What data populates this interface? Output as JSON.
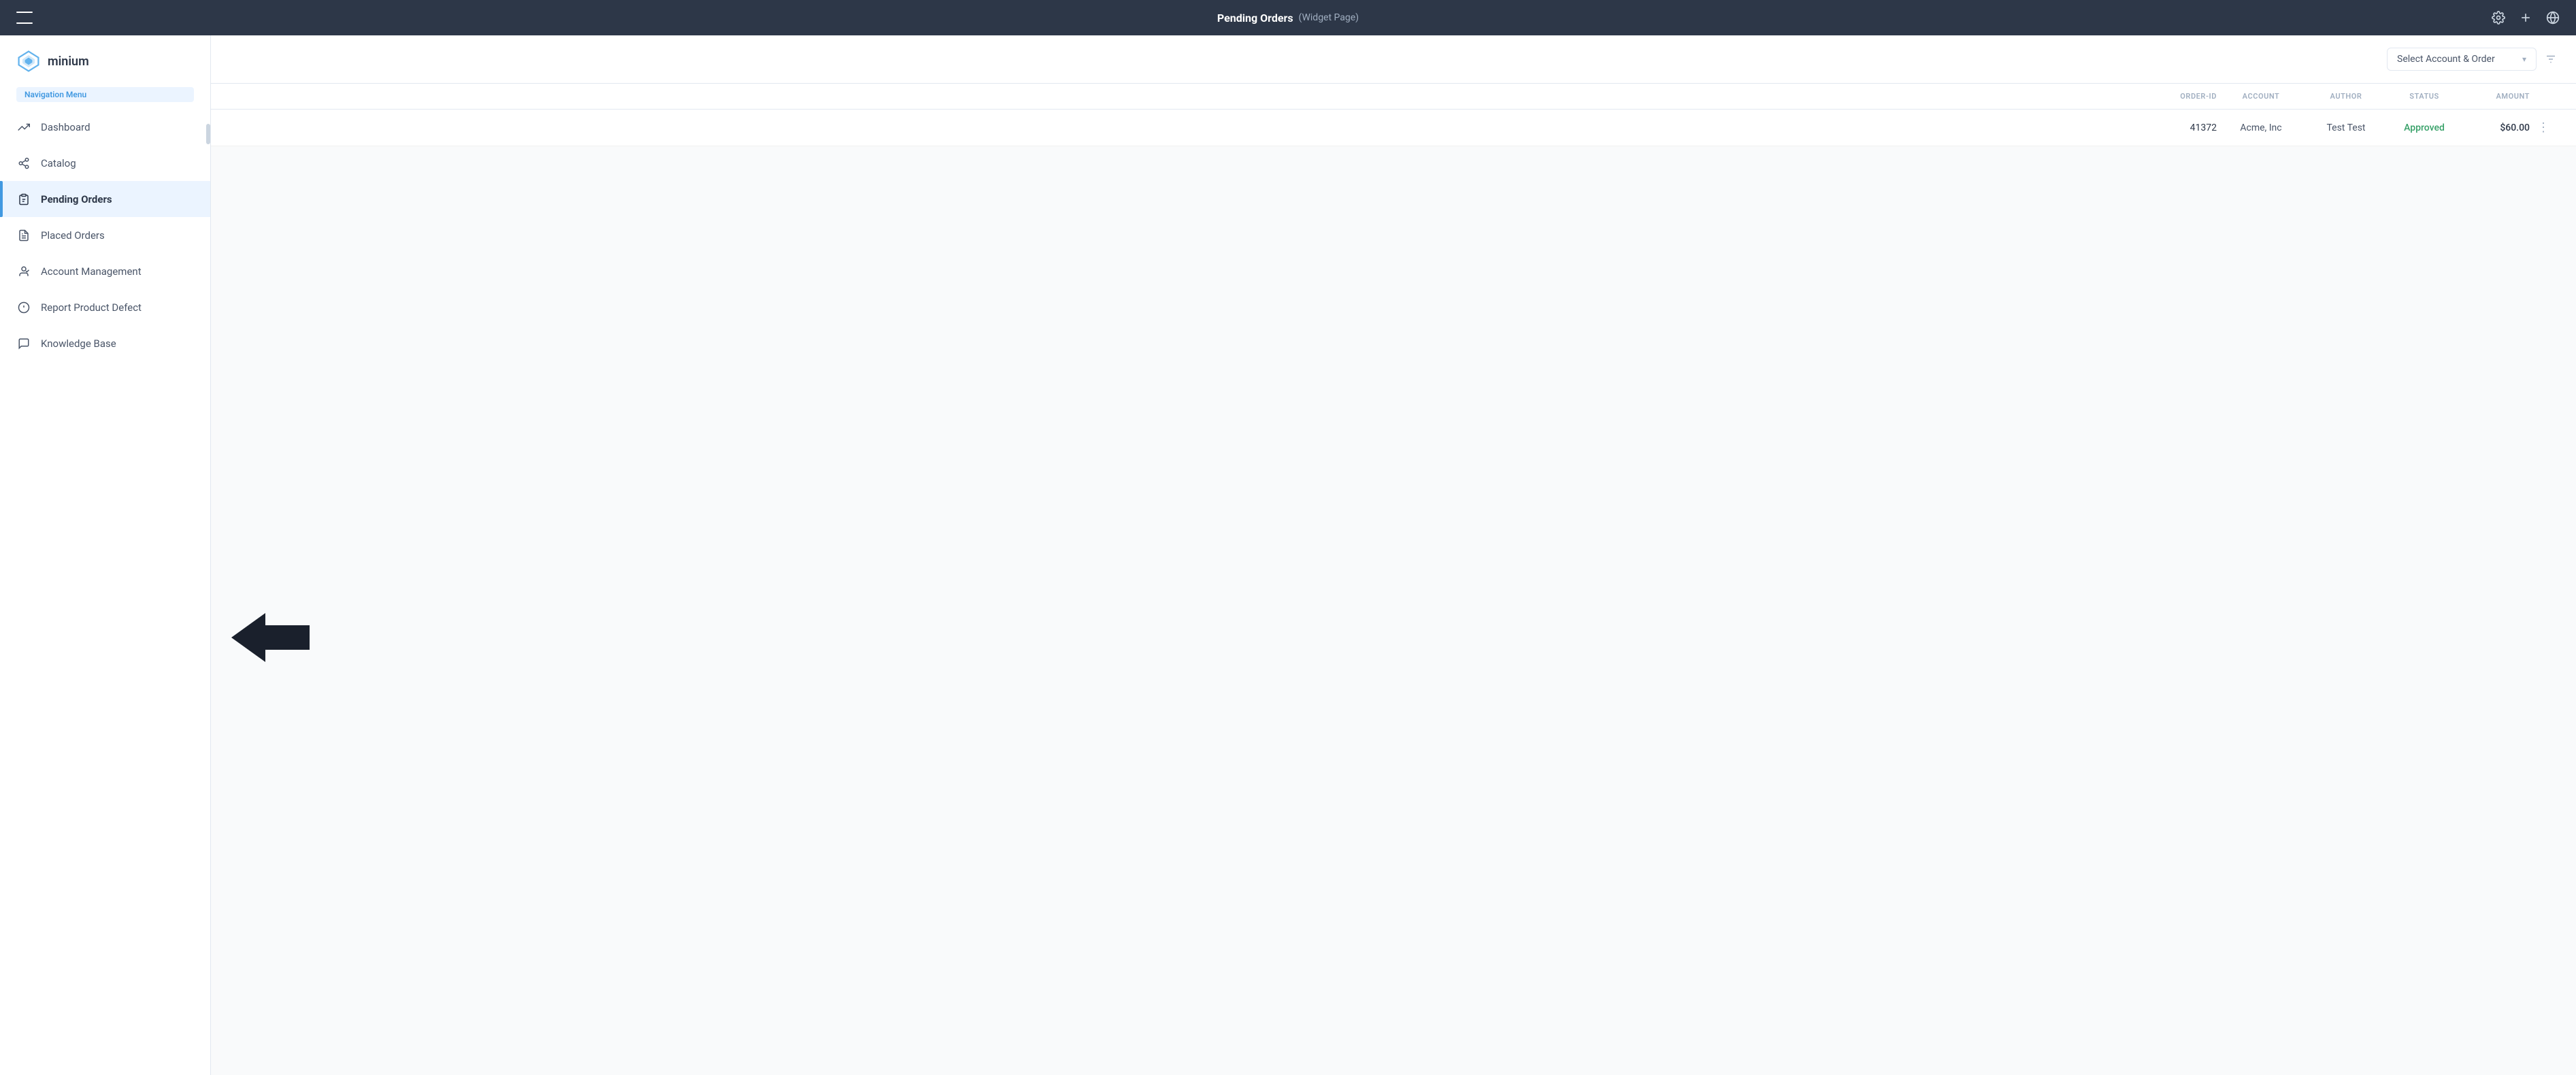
{
  "topbar": {
    "title": "Pending Orders",
    "subtitle": "(Widget Page)",
    "icons": {
      "sidebar_toggle": "sidebar-toggle",
      "settings": "⚙",
      "add": "+",
      "globe": "🌐"
    }
  },
  "sidebar": {
    "logo_text": "minium",
    "nav_menu_label": "Navigation Menu",
    "items": [
      {
        "id": "dashboard",
        "label": "Dashboard",
        "icon": "trending-up",
        "active": false
      },
      {
        "id": "catalog",
        "label": "Catalog",
        "icon": "tag",
        "active": false
      },
      {
        "id": "pending-orders",
        "label": "Pending Orders",
        "icon": "clipboard-list",
        "active": true
      },
      {
        "id": "placed-orders",
        "label": "Placed Orders",
        "icon": "file-text",
        "active": false
      },
      {
        "id": "account-management",
        "label": "Account Management",
        "icon": "user-check",
        "active": false
      },
      {
        "id": "report-defect",
        "label": "Report Product Defect",
        "icon": "alert-circle",
        "active": false
      },
      {
        "id": "knowledge-base",
        "label": "Knowledge Base",
        "icon": "message-square",
        "active": false
      }
    ]
  },
  "content_header": {
    "select_placeholder": "Select Account & Order",
    "chevron": "▾"
  },
  "table": {
    "columns": [
      {
        "id": "order-id",
        "label": "ORDER-ID"
      },
      {
        "id": "account",
        "label": "ACCOUNT"
      },
      {
        "id": "author",
        "label": "AUTHOR"
      },
      {
        "id": "status",
        "label": "STATUS"
      },
      {
        "id": "amount",
        "label": "AMOUNT"
      }
    ],
    "rows": [
      {
        "order_id": "41372",
        "account": "Acme, Inc",
        "author": "Test Test",
        "status": "Approved",
        "amount": "$60.00"
      }
    ]
  },
  "arrow": {
    "direction": "left",
    "color": "#1a202c"
  }
}
